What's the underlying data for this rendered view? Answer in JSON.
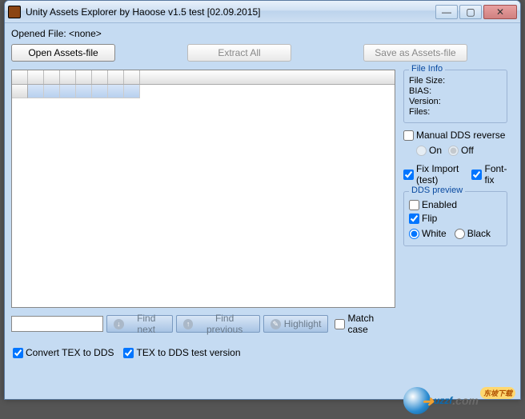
{
  "window": {
    "title": "Unity Assets Explorer by Haoose v1.5 test [02.09.2015]"
  },
  "opened_file_label": "Opened File: <none>",
  "buttons": {
    "open": "Open Assets-file",
    "extract": "Extract All",
    "saveas": "Save as Assets-file"
  },
  "search": {
    "placeholder": "",
    "find_next": "Find next",
    "find_prev": "Find previous",
    "highlight": "Highlight",
    "match_case": "Match case"
  },
  "fileinfo": {
    "legend": "File Info",
    "size_label": "File Size:",
    "bias_label": "BIAS:",
    "version_label": "Version:",
    "files_label": "Files:"
  },
  "manual_dds": {
    "label": "Manual DDS reverse",
    "on": "On",
    "off": "Off"
  },
  "fix_import": "Fix Import (test)",
  "font_fix": "Font-fix",
  "dds_preview": {
    "legend": "DDS preview",
    "enabled": "Enabled",
    "flip": "Flip",
    "white": "White",
    "black": "Black"
  },
  "bottom": {
    "convert": "Convert TEX to DDS",
    "testver": "TEX to DDS test version"
  },
  "watermark": {
    "text": "uzzf",
    "suffix": ".com",
    "badge": "东坡下载"
  }
}
